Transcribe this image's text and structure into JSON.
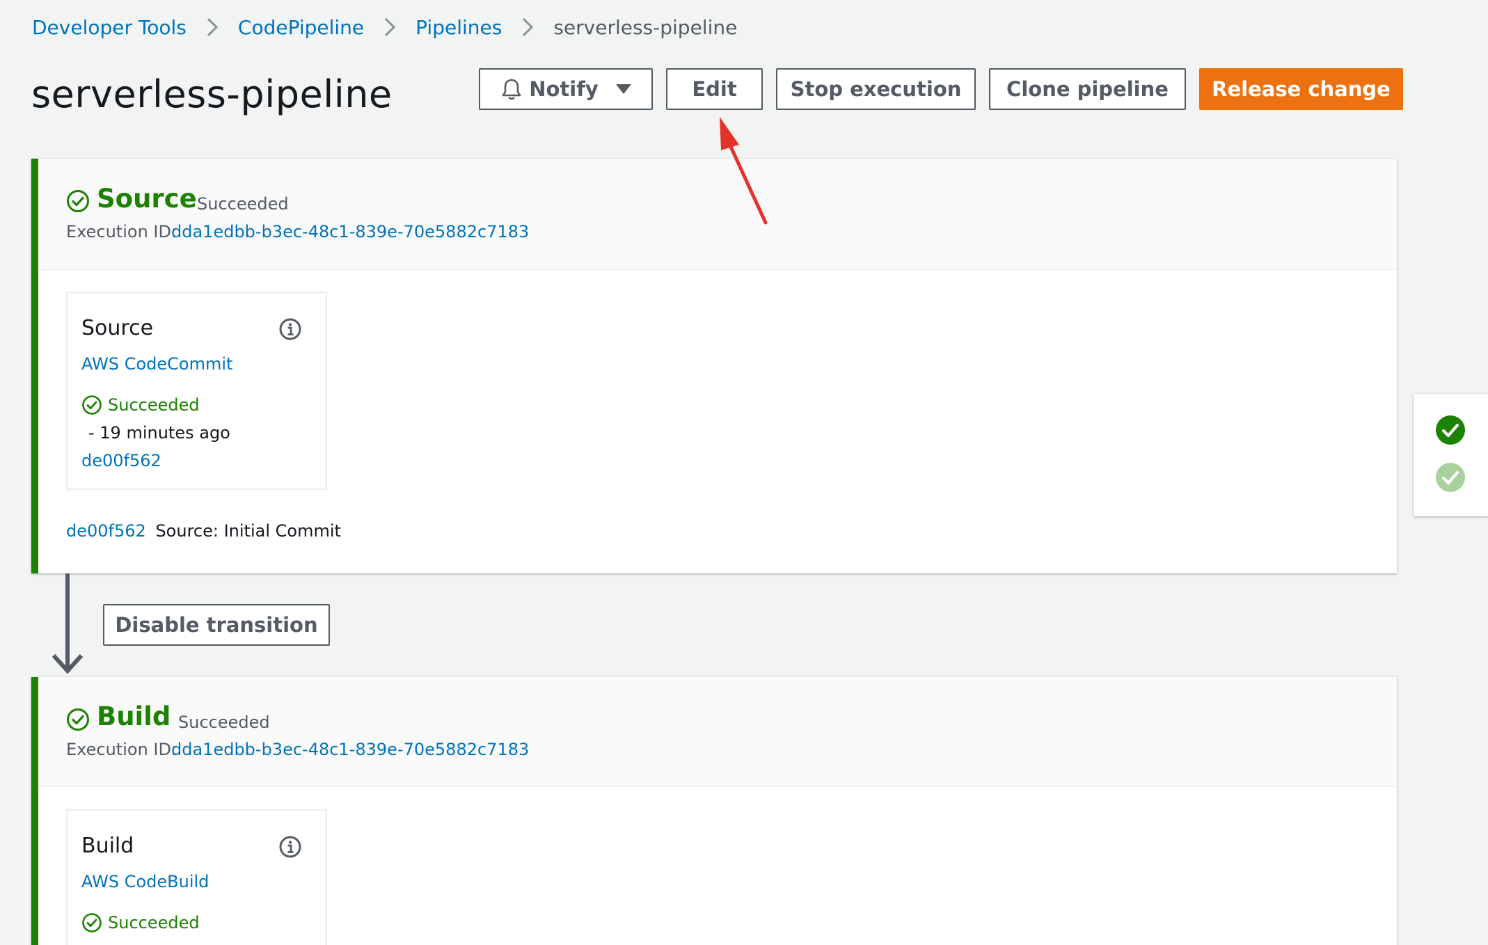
{
  "breadcrumb": {
    "items": [
      "Developer Tools",
      "CodePipeline",
      "Pipelines"
    ],
    "current": "serverless-pipeline"
  },
  "page": {
    "title": "serverless-pipeline"
  },
  "header_buttons": {
    "notify": "Notify",
    "edit": "Edit",
    "stop": "Stop execution",
    "clone": "Clone pipeline",
    "release": "Release change"
  },
  "stages": [
    {
      "name": "Source",
      "status": "Succeeded",
      "execution_label": "Execution ID:",
      "execution_id": "dda1edbb-b3ec-48c1-839e-70e5882c7183",
      "action": {
        "name": "Source",
        "provider": "AWS CodeCommit",
        "status": "Succeeded",
        "time": "-  19 minutes ago",
        "commit": "de00f562"
      },
      "footer": {
        "commit_id": "de00f562",
        "message": "Source: Initial Commit"
      }
    },
    {
      "name": "Build",
      "status": "Succeeded",
      "execution_label": "Execution ID:",
      "execution_id": "dda1edbb-b3ec-48c1-839e-70e5882c7183",
      "action": {
        "name": "Build",
        "provider": "AWS CodeBuild",
        "status": "Succeeded"
      }
    }
  ],
  "transition": {
    "button": "Disable transition"
  },
  "colors": {
    "success": "#1d8102",
    "success_light": "#a9d19e",
    "link": "#0073bb",
    "primary": "#ec7211",
    "annotation_arrow": "#e53228"
  }
}
